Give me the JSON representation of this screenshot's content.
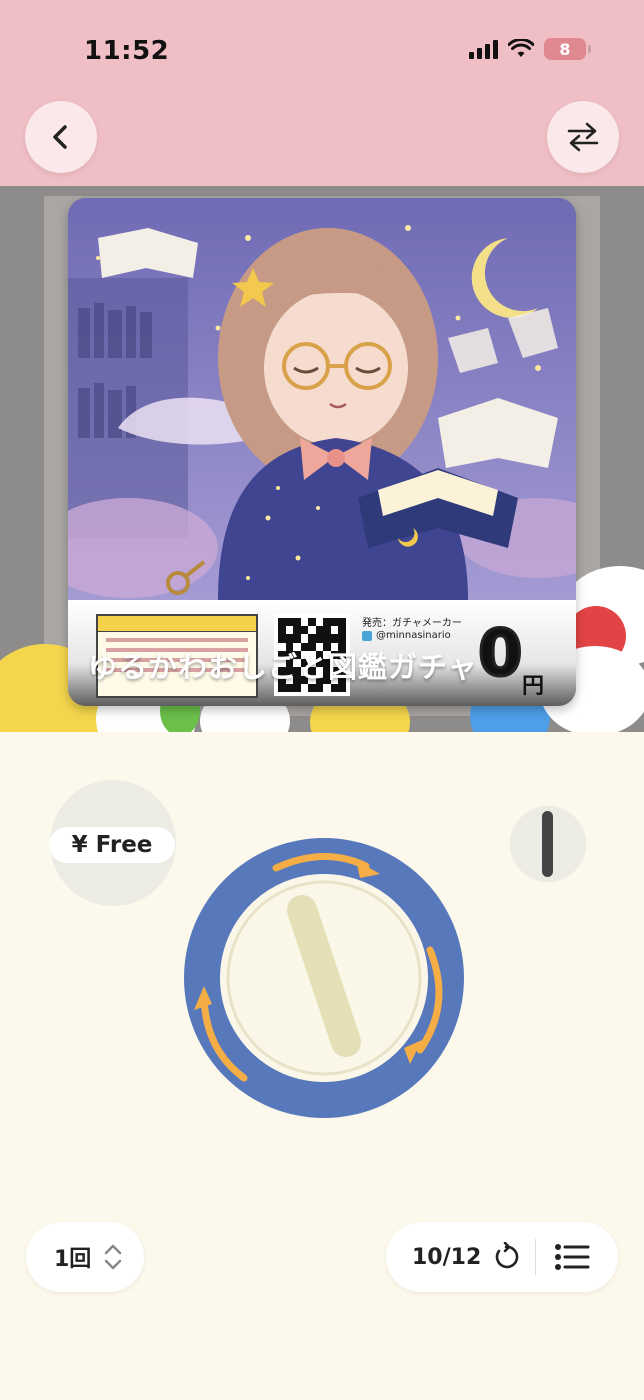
{
  "status_bar": {
    "time": "11:52",
    "battery_level": "8"
  },
  "header": {
    "back_icon": "chevron-left-icon",
    "swap_icon": "swap-arrows-icon"
  },
  "gacha": {
    "title": "ゆるかわおしごと図鑑ガチャ",
    "price_value": "0",
    "price_unit": "円",
    "publisher": "発売：ガチャメーカー",
    "handle": "@minnasinario"
  },
  "controls": {
    "price_chip": "¥ Free",
    "pull_count": "1回",
    "stock": "10/12",
    "colors": {
      "dial_ring": "#5778bb",
      "arrows": "#f5ad45",
      "knob": "#e5dfb8"
    }
  }
}
